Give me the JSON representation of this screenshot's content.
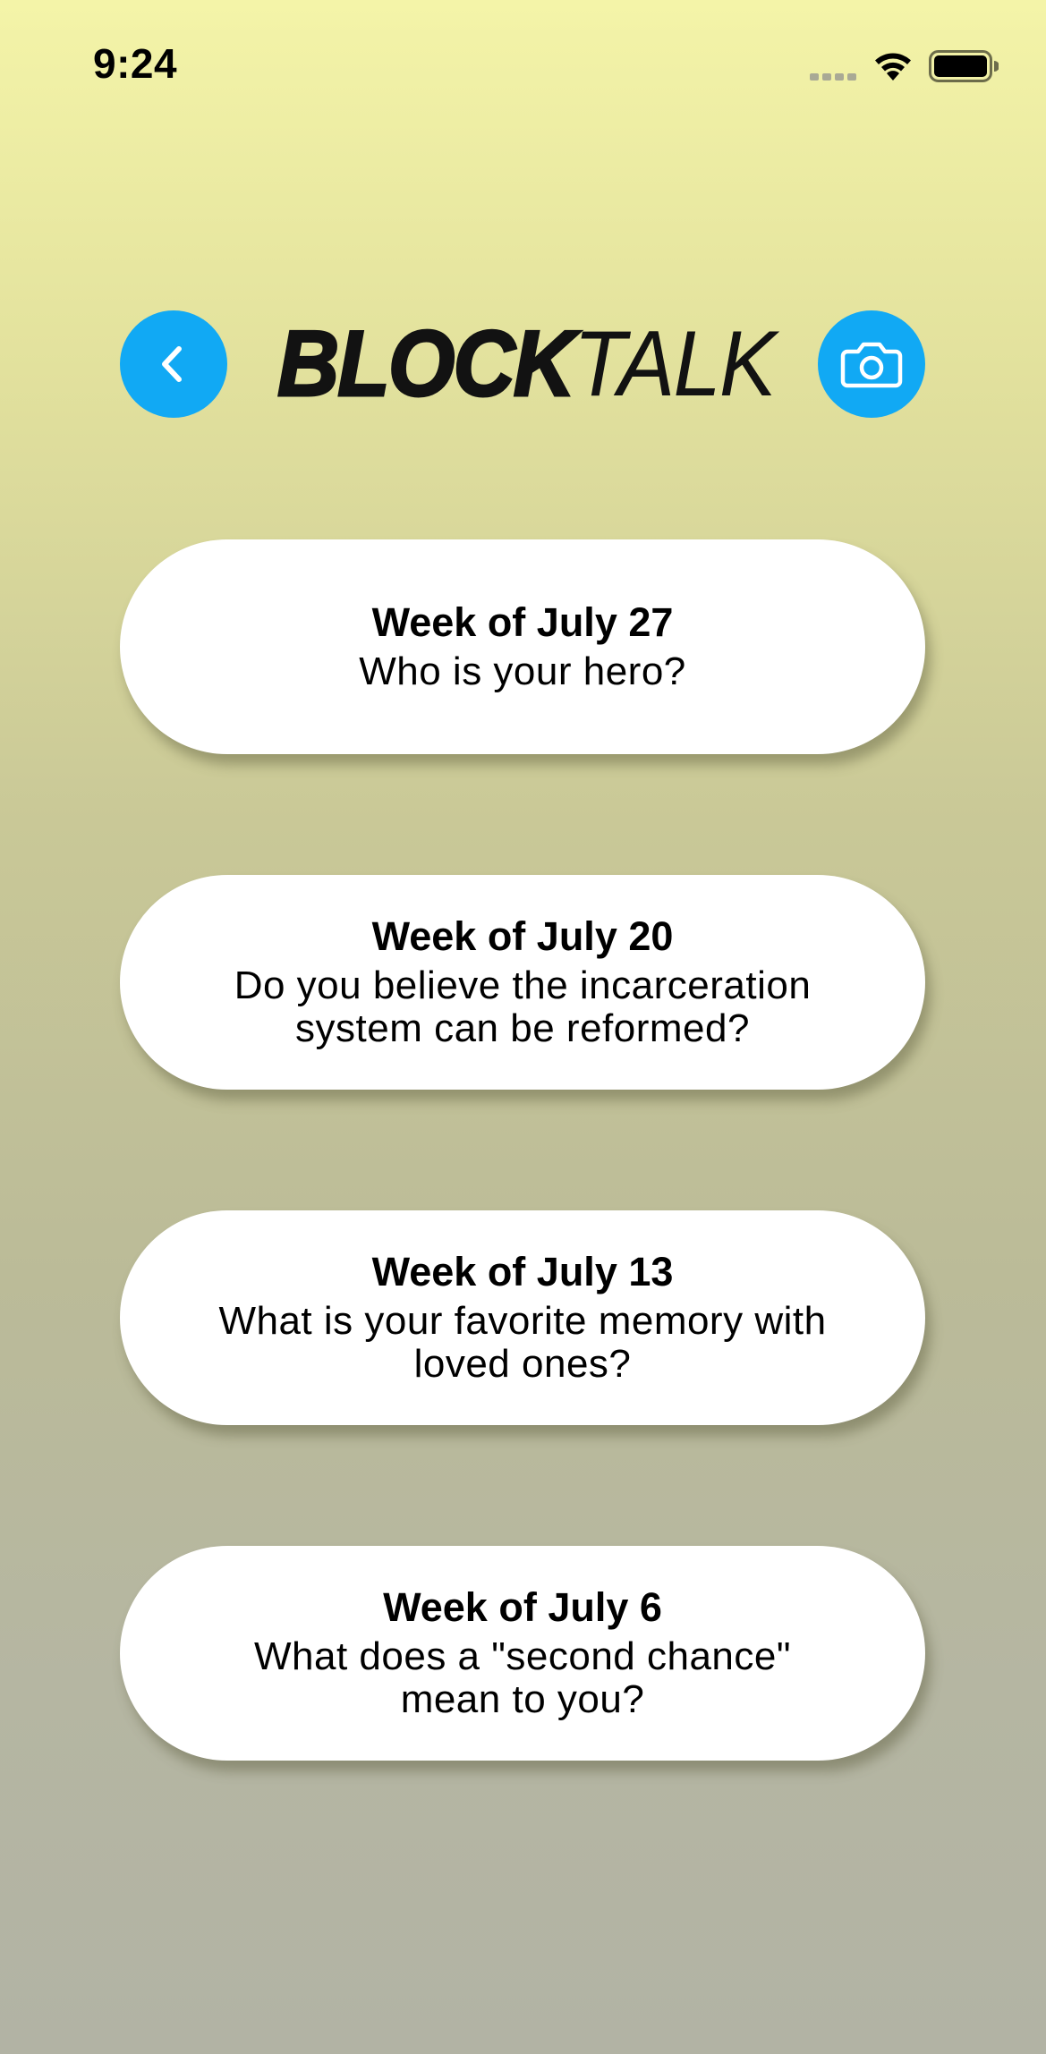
{
  "status_bar": {
    "time": "9:24"
  },
  "header": {
    "logo_bold": "BLOCK",
    "logo_light": "TALK",
    "back_icon": "chevron-left-icon",
    "camera_icon": "camera-icon"
  },
  "colors": {
    "accent": "#11a9f4",
    "card_background": "#ffffff",
    "gradient_top": "#f4f4a8",
    "gradient_bottom": "#b2b3a4"
  },
  "prompts": [
    {
      "week": "Week of July 27",
      "question": "Who is your hero?"
    },
    {
      "week": "Week of July 20",
      "question": "Do you believe the incarceration system can be reformed?"
    },
    {
      "week": "Week of July 13",
      "question": "What is your favorite memory with loved ones?"
    },
    {
      "week": "Week of July 6",
      "question": "What does a \"second chance\" mean to you?"
    }
  ]
}
